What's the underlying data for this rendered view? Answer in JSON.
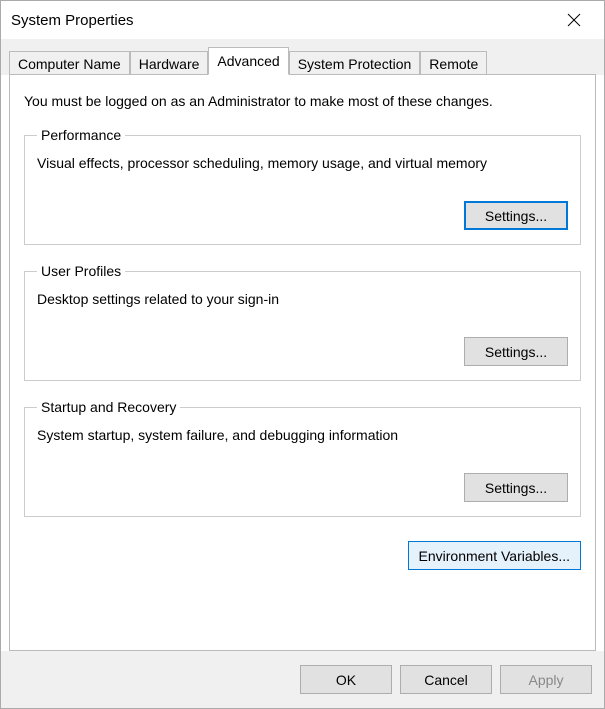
{
  "window": {
    "title": "System Properties"
  },
  "tabs": {
    "computer_name": "Computer Name",
    "hardware": "Hardware",
    "advanced": "Advanced",
    "system_protection": "System Protection",
    "remote": "Remote"
  },
  "content": {
    "admin_note": "You must be logged on as an Administrator to make most of these changes.",
    "performance": {
      "legend": "Performance",
      "desc": "Visual effects, processor scheduling, memory usage, and virtual memory",
      "button": "Settings..."
    },
    "user_profiles": {
      "legend": "User Profiles",
      "desc": "Desktop settings related to your sign-in",
      "button": "Settings..."
    },
    "startup_recovery": {
      "legend": "Startup and Recovery",
      "desc": "System startup, system failure, and debugging information",
      "button": "Settings..."
    },
    "env_button": "Environment Variables..."
  },
  "buttons": {
    "ok": "OK",
    "cancel": "Cancel",
    "apply": "Apply"
  }
}
